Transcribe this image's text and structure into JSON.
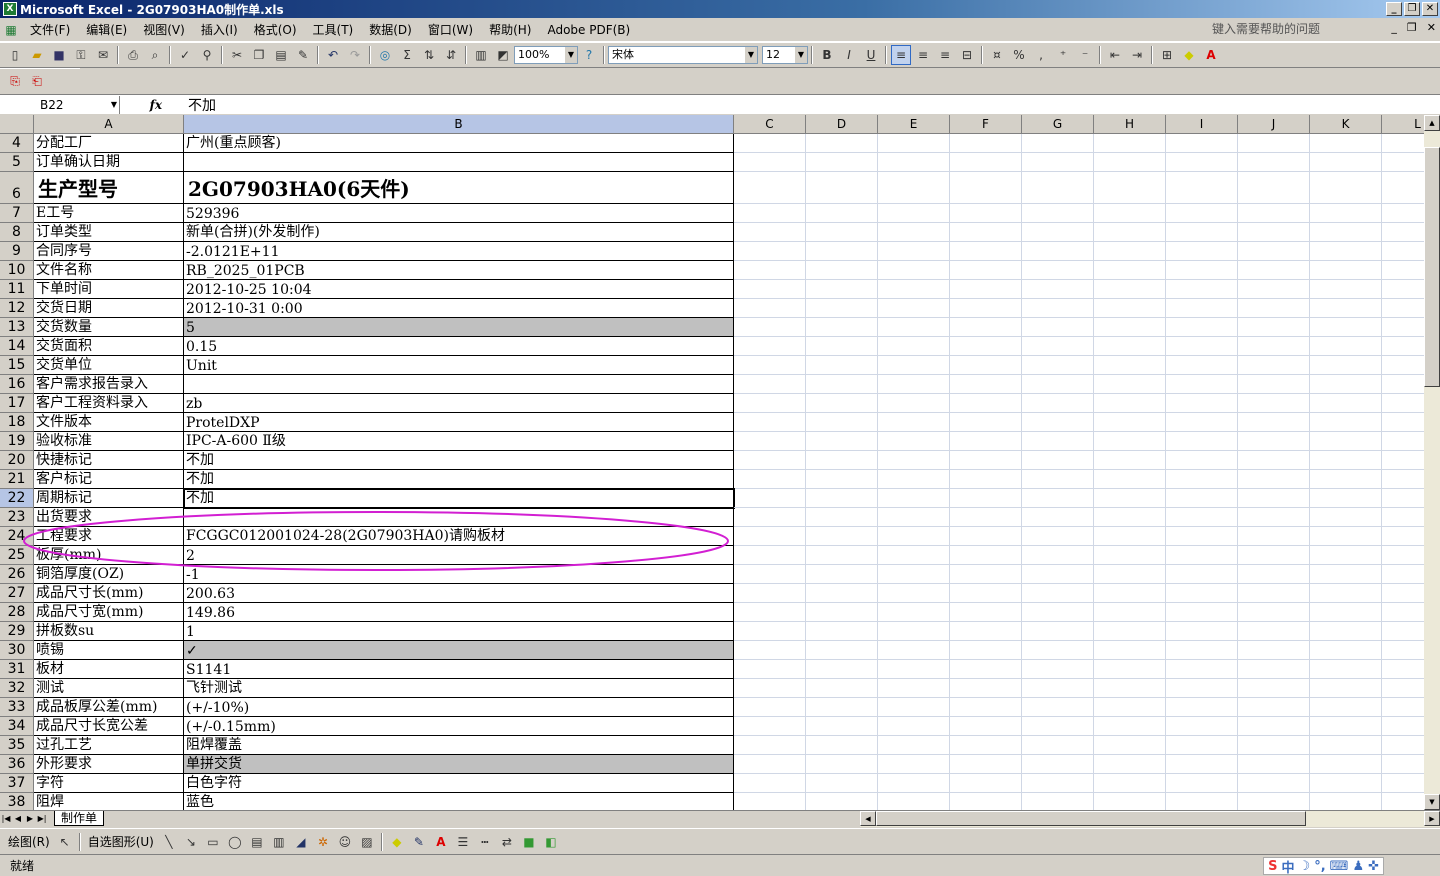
{
  "window": {
    "title": "Microsoft Excel - 2G07903HA0制作单.xls",
    "app_icon": "X"
  },
  "menu": [
    "文件(F)",
    "编辑(E)",
    "视图(V)",
    "插入(I)",
    "格式(O)",
    "工具(T)",
    "数据(D)",
    "窗口(W)",
    "帮助(H)",
    "Adobe PDF(B)"
  ],
  "help_box": "键入需要帮助的问题",
  "toolbar": {
    "zoom": "100%",
    "font": "宋体",
    "size": "12"
  },
  "formula": {
    "name_box": "B22",
    "fx": "fx",
    "content": "不加"
  },
  "columns": [
    "A",
    "B",
    "C",
    "D",
    "E",
    "F",
    "G",
    "H",
    "I",
    "J",
    "K",
    "L"
  ],
  "rows": [
    {
      "n": "4",
      "a": "分配工厂",
      "b": "广州(重点顾客)"
    },
    {
      "n": "5",
      "a": "订单确认日期",
      "b": ""
    },
    {
      "n": "6",
      "a": "生产型号",
      "b": "2G07903HA0(6天件)"
    },
    {
      "n": "7",
      "a": "E工号",
      "b": "529396"
    },
    {
      "n": "8",
      "a": "订单类型",
      "b": "新单(合拼)(外发制作)"
    },
    {
      "n": "9",
      "a": "合同序号",
      "b": "-2.0121E+11"
    },
    {
      "n": "10",
      "a": "文件名称",
      "b": "RB_2025_01PCB"
    },
    {
      "n": "11",
      "a": "下单时间",
      "b": "2012-10-25 10:04"
    },
    {
      "n": "12",
      "a": "交货日期",
      "b": "2012-10-31 0:00"
    },
    {
      "n": "13",
      "a": "交货数量",
      "b": "5"
    },
    {
      "n": "14",
      "a": "交货面积",
      "b": "0.15"
    },
    {
      "n": "15",
      "a": "交货单位",
      "b": "Unit"
    },
    {
      "n": "16",
      "a": "客户需求报告录入",
      "b": ""
    },
    {
      "n": "17",
      "a": "客户工程资料录入",
      "b": "zb"
    },
    {
      "n": "18",
      "a": "文件版本",
      "b": "ProtelDXP"
    },
    {
      "n": "19",
      "a": "验收标准",
      "b": "IPC-A-600 Ⅱ级"
    },
    {
      "n": "20",
      "a": "快捷标记",
      "b": "不加"
    },
    {
      "n": "21",
      "a": "客户标记",
      "b": "不加"
    },
    {
      "n": "22",
      "a": "周期标记",
      "b": "不加"
    },
    {
      "n": "23",
      "a": "出货要求",
      "b": ""
    },
    {
      "n": "24",
      "a": "工程要求",
      "b": "FCGGC012001024-28(2G07903HA0)请购板材"
    },
    {
      "n": "25",
      "a": "板厚(mm)",
      "b": "2"
    },
    {
      "n": "26",
      "a": "铜箔厚度(OZ)",
      "b": "-1"
    },
    {
      "n": "27",
      "a": "成品尺寸长(mm)",
      "b": "200.63"
    },
    {
      "n": "28",
      "a": "成品尺寸宽(mm)",
      "b": "149.86"
    },
    {
      "n": "29",
      "a": "拼板数su",
      "b": "1"
    },
    {
      "n": "30",
      "a": "喷锡",
      "b": "✓"
    },
    {
      "n": "31",
      "a": "板材",
      "b": "S1141"
    },
    {
      "n": "32",
      "a": "测试",
      "b": "飞针测试"
    },
    {
      "n": "33",
      "a": "成品板厚公差(mm)",
      "b": "(+/-10%)"
    },
    {
      "n": "34",
      "a": "成品尺寸长宽公差",
      "b": "(+/-0.15mm)"
    },
    {
      "n": "35",
      "a": "过孔工艺",
      "b": "阻焊覆盖"
    },
    {
      "n": "36",
      "a": "外形要求",
      "b": "单拼交货"
    },
    {
      "n": "37",
      "a": "字符",
      "b": "白色字符"
    },
    {
      "n": "38",
      "a": "阻焊",
      "b": "蓝色"
    }
  ],
  "selected_cell": "B22",
  "sheet_tab": "制作单",
  "draw_toolbar": {
    "draw": "绘图(R)",
    "autoshapes": "自选图形(U)"
  },
  "status": "就绪",
  "ime": "中",
  "colors": {
    "highlight_ring": "#d21fd2",
    "gray_cell": "#c0c0c0",
    "selection": "#b6c5e5"
  }
}
